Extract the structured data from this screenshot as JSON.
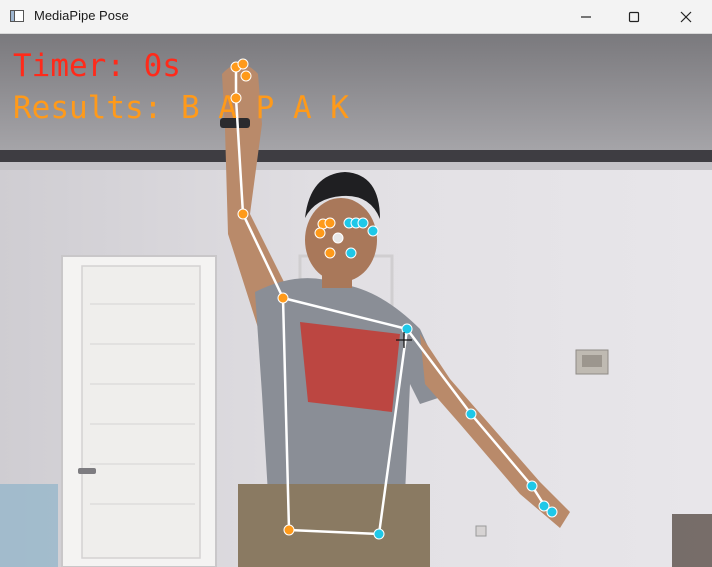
{
  "window": {
    "title": "MediaPipe Pose",
    "controls": {
      "minimize": "minimize",
      "maximize": "maximize",
      "close": "close"
    }
  },
  "overlay": {
    "timer": "Timer: 0s",
    "results": "Results: B A P A K"
  },
  "colors": {
    "left_landmark": "#ff9a1a",
    "right_landmark": "#1ec8e8",
    "connection": "#ffffff",
    "timer_text": "#ff2a1a",
    "results_text": "#ff9a1a"
  }
}
